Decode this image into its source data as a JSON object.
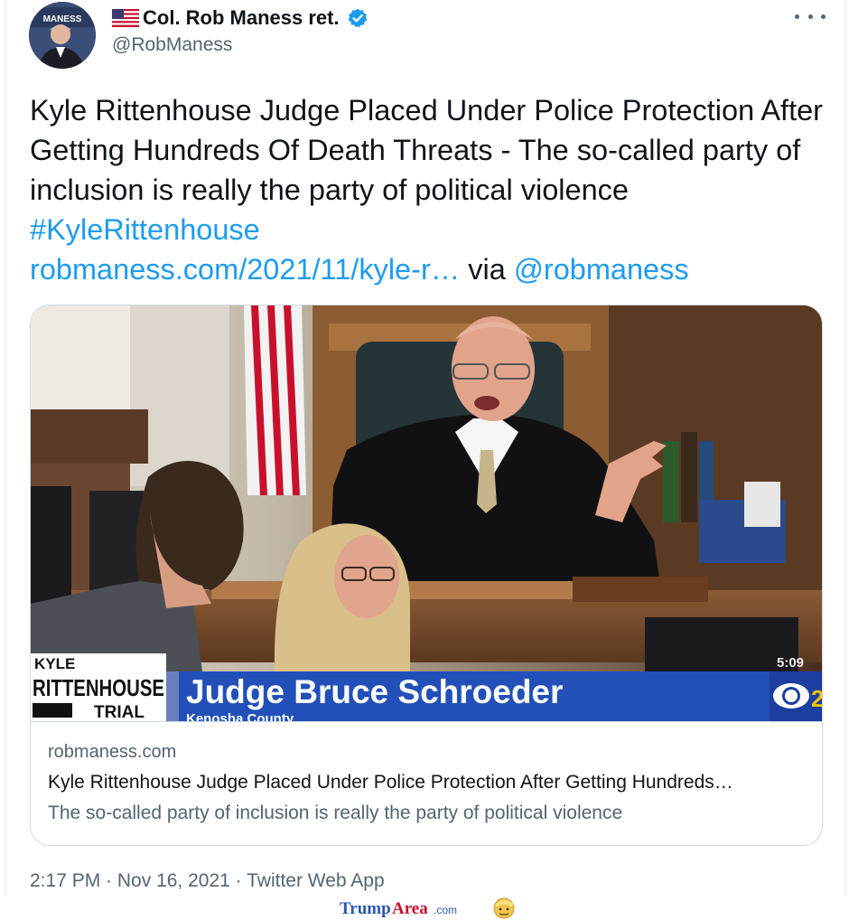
{
  "author": {
    "display_name": "Col. Rob Maness ret.",
    "handle": "@RobManess",
    "avatar_banner_text": "MANESS",
    "flag_icon": "us-flag-icon",
    "verified_icon": "verified-badge-icon",
    "verified_color": "#1d9bf0"
  },
  "tweet": {
    "text": "Kyle Rittenhouse Judge Placed Under Police Protection After Getting Hundreds Of Death Threats - The so-called party of inclusion is really the party of political violence ",
    "hashtag": "#KyleRittenhouse",
    "url": "robmaness.com/2021/11/kyle-r…",
    "via_text": " via ",
    "mention": "@robmaness",
    "link_color": "#1d9bf0"
  },
  "card": {
    "image_overlay": {
      "show_name_line1": "KYLE",
      "show_name_line2": "RITTENHOUSE",
      "show_name_line3": "TRIAL",
      "lower_third_name": "Judge Bruce Schroeder",
      "lower_third_sub": "Kenosha County",
      "clock": "5:09"
    },
    "domain": "robmaness.com",
    "title": "Kyle Rittenhouse Judge Placed Under Police Protection After Getting Hundreds…",
    "description": "The so-called party of inclusion is really the party of political violence"
  },
  "meta": {
    "time": "2:17 PM",
    "separator": " · ",
    "date": "Nov 16, 2021",
    "source": "Twitter Web App"
  },
  "watermark": {
    "text_trump": "Trump",
    "text_area": "Area",
    "text_com": ".com"
  }
}
